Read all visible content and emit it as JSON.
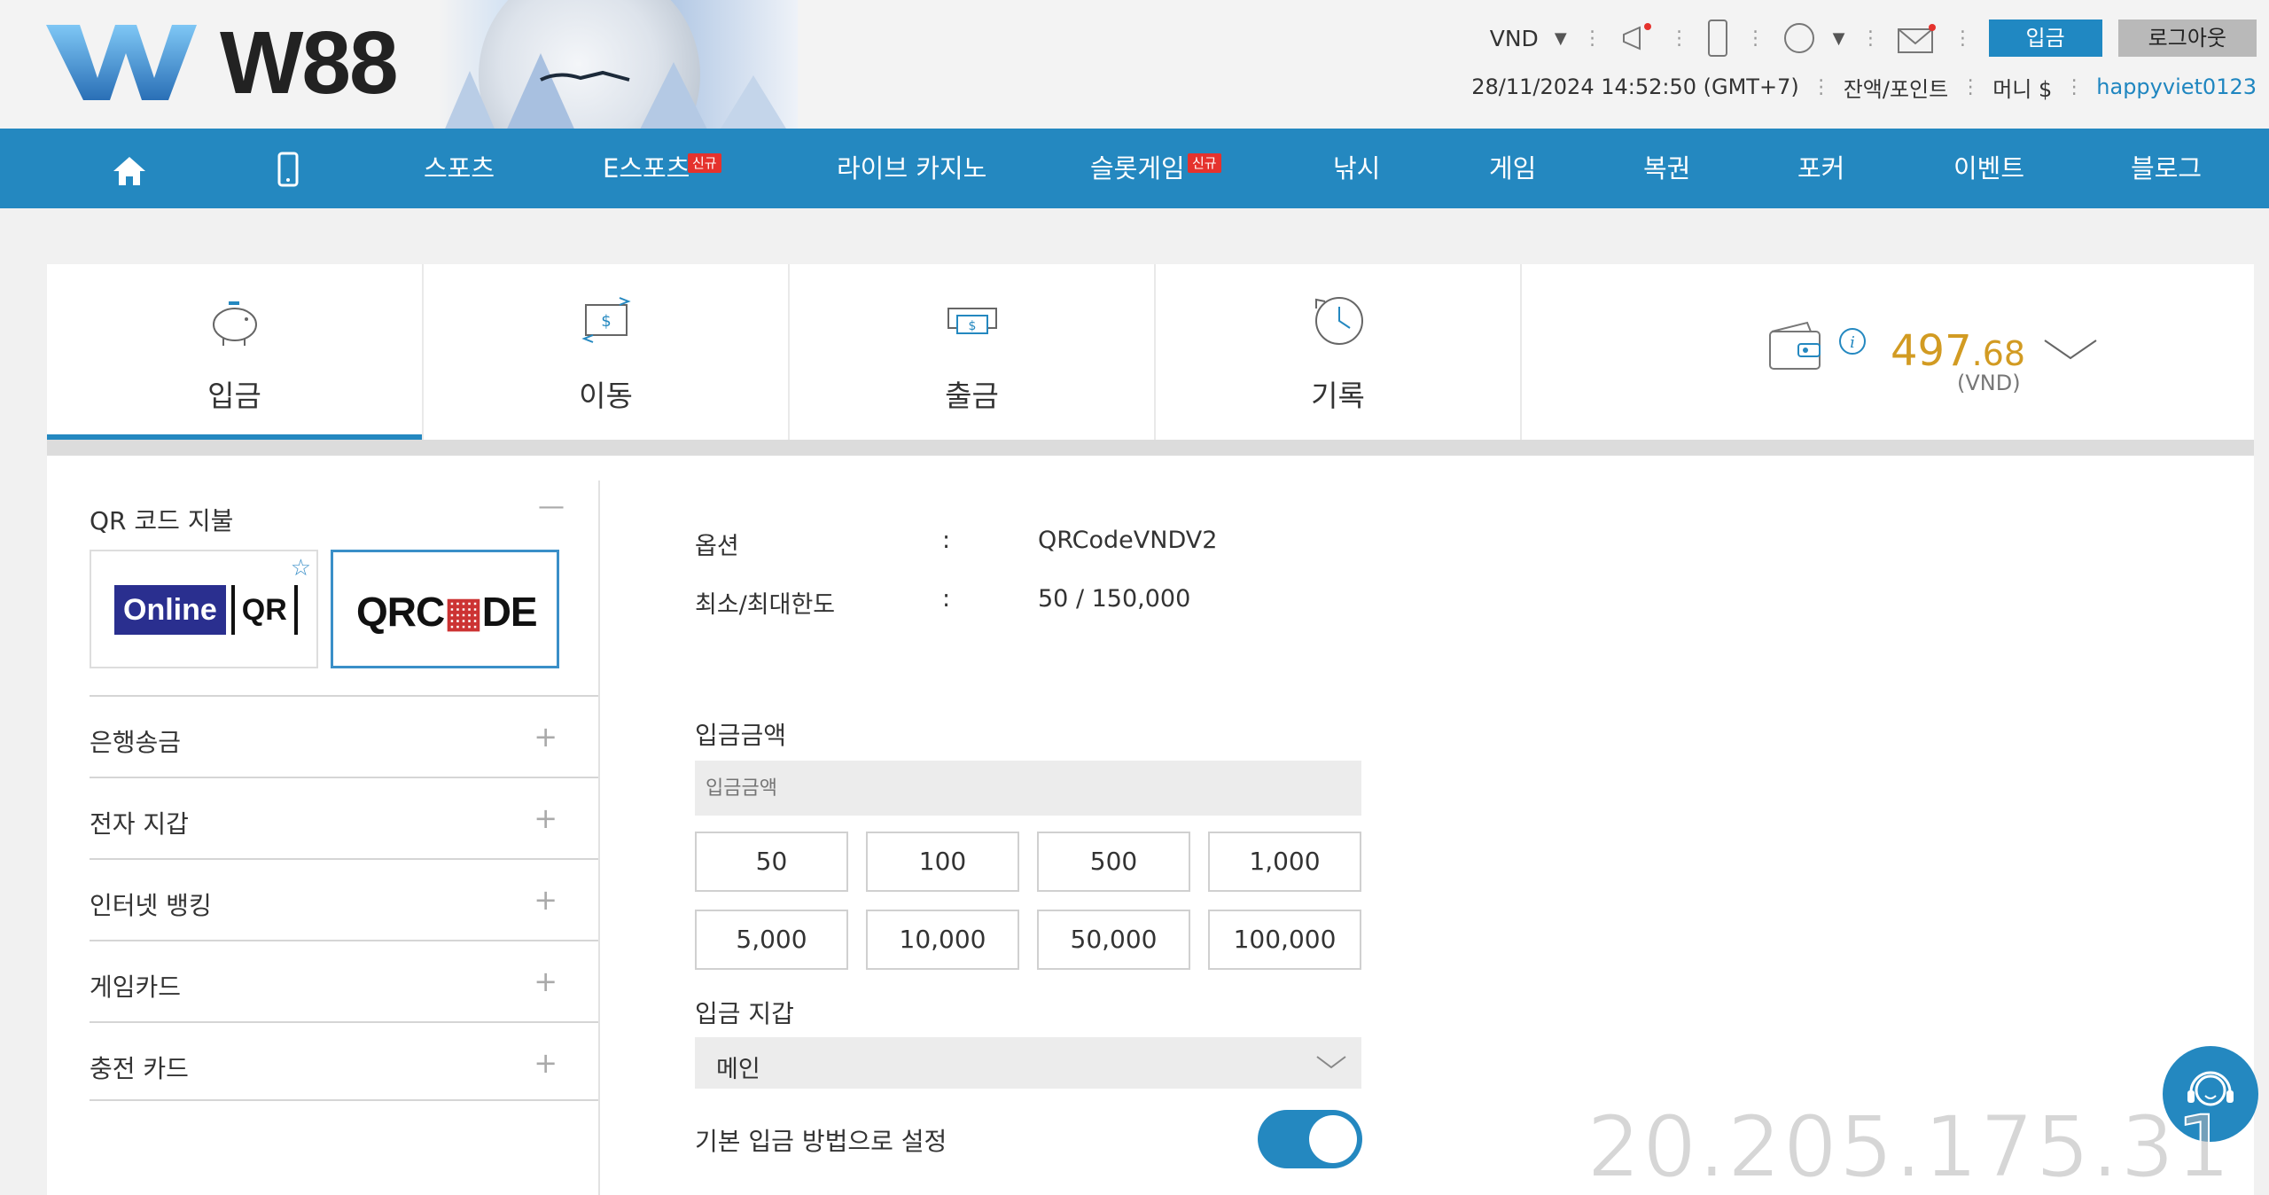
{
  "brand": {
    "name": "W88"
  },
  "topbar": {
    "currency": "VND",
    "deposit_button": "입금",
    "logout_button": "로그아웃"
  },
  "infobar": {
    "datetime": "28/11/2024 14:52:50 (GMT+7)",
    "balance_points": "잔액/포인트",
    "money": "머니 $",
    "username": "happyviet0123"
  },
  "nav": {
    "items": [
      {
        "label": "스포츠"
      },
      {
        "label": "E스포츠",
        "badge": "신규"
      },
      {
        "label": "라이브 카지노"
      },
      {
        "label": "슬롯게임",
        "badge": "신규"
      },
      {
        "label": "낚시"
      },
      {
        "label": "게임"
      },
      {
        "label": "복권"
      },
      {
        "label": "포커"
      },
      {
        "label": "이벤트"
      },
      {
        "label": "블로그"
      }
    ]
  },
  "tabs": [
    {
      "label": "입금",
      "icon": "piggy-bank-icon",
      "active": true
    },
    {
      "label": "이동",
      "icon": "transfer-icon"
    },
    {
      "label": "출금",
      "icon": "withdraw-icon"
    },
    {
      "label": "기록",
      "icon": "history-icon"
    }
  ],
  "balance": {
    "amount_int": "497",
    "amount_dec": ".68",
    "currency": "(VND)"
  },
  "sidebar": {
    "qr_title": "QR 코드 지불",
    "qr_options": [
      {
        "name": "Online [QR]"
      },
      {
        "name": "QRCODE"
      }
    ],
    "methods": [
      {
        "label": "은행송금"
      },
      {
        "label": "전자 지갑"
      },
      {
        "label": "인터넷 뱅킹"
      },
      {
        "label": "게임카드"
      },
      {
        "label": "충전 카드"
      }
    ]
  },
  "form": {
    "option_label": "옵션",
    "option_value": "QRCodeVNDV2",
    "limit_label": "최소/최대한도",
    "limit_value": "50 / 150,000",
    "colon": ":",
    "amount_label": "입금금액",
    "amount_placeholder": "입금금액",
    "presets": [
      "50",
      "100",
      "500",
      "1,000",
      "5,000",
      "10,000",
      "50,000",
      "100,000"
    ],
    "wallet_label": "입금 지갑",
    "wallet_value": "메인",
    "default_label": "기본 입금 방법으로 설정",
    "default_on": true
  },
  "overlay": {
    "ip": "20.205.175.31"
  },
  "colors": {
    "primary": "#2488c0",
    "balance": "#d29b22",
    "badge": "#e5322d"
  }
}
